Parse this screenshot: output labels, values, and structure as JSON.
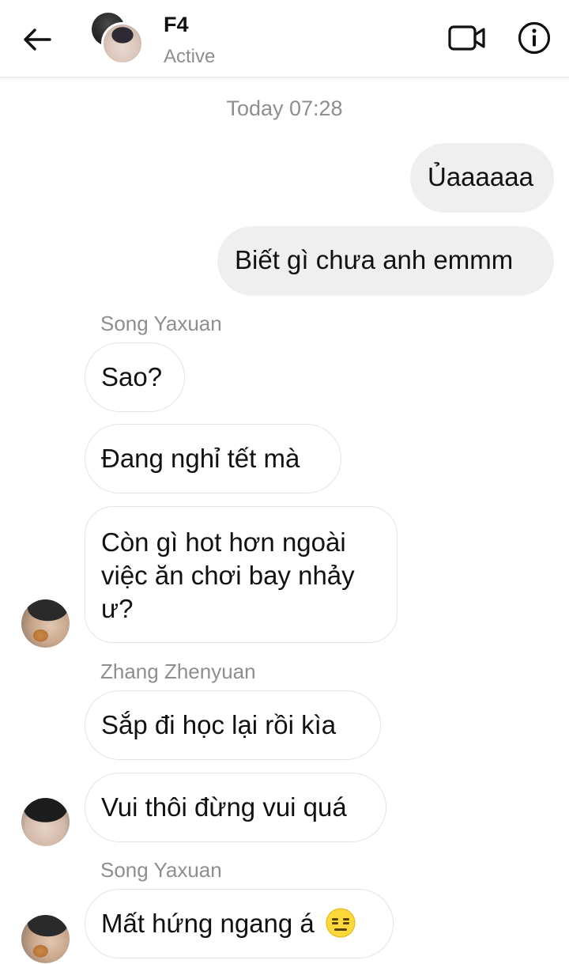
{
  "header": {
    "title": "F4",
    "status": "Active",
    "back_icon": "arrow-left-icon",
    "video_icon": "video-camera-icon",
    "info_icon": "info-icon"
  },
  "chat": {
    "timestamp": "Today 07:28",
    "outgoing": [
      "Ủaaaaaa",
      "Biết gì chưa anh emmm"
    ],
    "senders": {
      "song_1": "Song Yaxuan",
      "zhang": "Zhang Zhenyuan",
      "song_2": "Song Yaxuan"
    },
    "incoming": [
      "Sao?",
      "Đang nghỉ tết mà",
      "Còn gì hot hơn ngoài",
      "việc ăn chơi bay nhảy",
      "ư?",
      "Sắp đi học lại rồi kìa",
      "Vui thôi đừng vui quá",
      "Mất hứng ngang á"
    ],
    "emoji": "expressionless-face-emoji"
  },
  "colors": {
    "outgoing_bubble": "#efefef",
    "incoming_border": "#e3e3e3",
    "secondary_text": "#8e8e8e",
    "primary_text": "#111111"
  }
}
